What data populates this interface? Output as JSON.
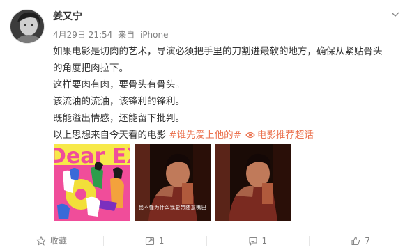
{
  "post": {
    "username": "姜又宁",
    "date": "4月29日 21:54",
    "source_prefix": "来自",
    "source": "iPhone",
    "lines": [
      "如果电影是切肉的艺术，导演必须把手里的刀割进最软的地方，确保从紧贴骨头",
      "的角度把肉拉下。",
      "这样要肉有肉，要骨头有骨头。",
      "该流油的流油，该锋利的锋利。",
      "既能溢出情感，还能留下批判。"
    ],
    "last_line_text": "以上思想来自今天看的电影 ",
    "hashtag": "#谁先爱上他的#",
    "topic_link": "电影推荐超话",
    "images": [
      {
        "name": "poster",
        "text": "Dear EX."
      },
      {
        "name": "still-1",
        "caption": "我不懂为什么我要带随意嘴巴"
      },
      {
        "name": "still-2",
        "caption": ""
      }
    ]
  },
  "actions": {
    "favorite": "收藏",
    "repost": "1",
    "comment": "1",
    "like": "7"
  },
  "icons": [
    "chevron-down-icon",
    "eye-icon",
    "star-icon",
    "repost-icon",
    "comment-icon",
    "like-icon"
  ],
  "colors": {
    "accent": "#eb7350",
    "meta": "#808080",
    "text": "#333333"
  }
}
